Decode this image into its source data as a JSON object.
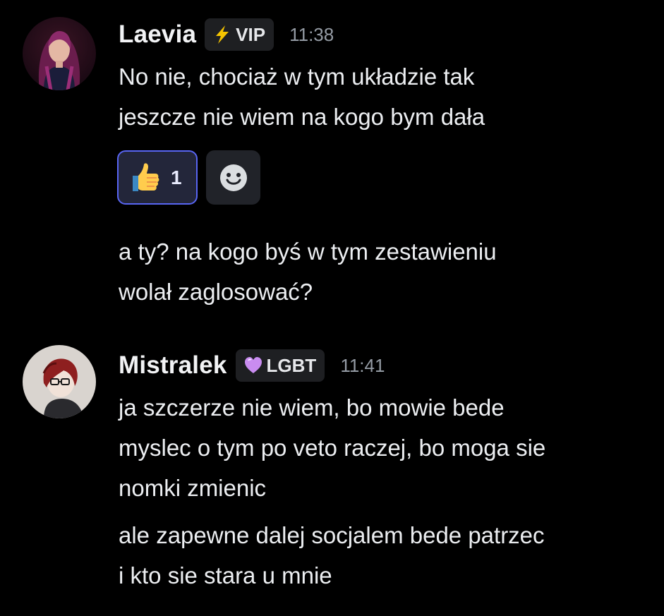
{
  "messages": [
    {
      "author": "Laevia",
      "role": {
        "icon": "lightning-icon",
        "label": "VIP",
        "color": "#f5c400"
      },
      "time": "11:38",
      "lines": [
        "No nie, chociaż w tym układzie tak",
        "jeszcze nie wiem na kogo bym dała"
      ],
      "reactions": [
        {
          "emoji": "thumbs-up-icon",
          "count": "1",
          "active": true
        }
      ],
      "add_reaction_icon": "smiley-add-reaction-icon",
      "followup_lines": [
        "a ty? na kogo byś w tym zestawieniu",
        "wolał zaglosować?"
      ]
    },
    {
      "author": "Mistralek",
      "role": {
        "icon": "purple-heart-icon",
        "label": "LGBT",
        "color": "#c98cf0"
      },
      "time": "11:41",
      "lines": [
        "ja szczerze nie wiem, bo mowie bede",
        "myslec o tym po veto raczej, bo moga sie",
        "nomki zmienic"
      ],
      "followup_lines": [
        "ale zapewne dalej socjalem bede patrzec",
        "i kto sie stara u mnie"
      ]
    }
  ],
  "colors": {
    "background": "#000000",
    "text": "#eceef1",
    "timestamp": "#949ba4",
    "reaction_active_border": "#5865f2"
  }
}
